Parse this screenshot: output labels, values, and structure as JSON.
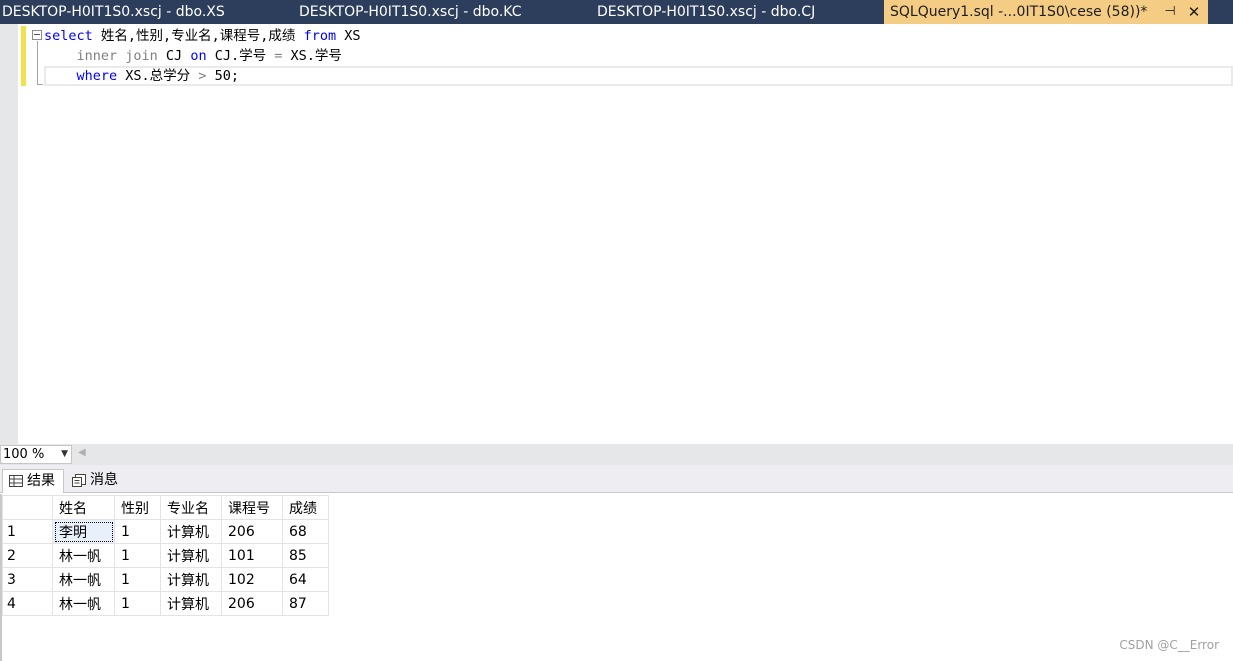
{
  "tabs": [
    {
      "label": "DESKTOP-H0IT1S0.xscj - dbo.XS"
    },
    {
      "label": "DESKTOP-H0IT1S0.xscj - dbo.KC"
    },
    {
      "label": "DESKTOP-H0IT1S0.xscj - dbo.CJ"
    },
    {
      "label": "SQLQuery1.sql -...0IT1S0\\cese (58))*",
      "pin_icon": "pin-icon",
      "close_icon": "close-icon"
    }
  ],
  "editor": {
    "line1": {
      "kw1": "select",
      "text1": " 姓名,性别,专业名,课程号,成绩 ",
      "kw2": "from",
      "text2": " XS"
    },
    "line2": {
      "indent": "    ",
      "fn1": "inner join",
      "text1": " CJ ",
      "kw1": "on",
      "text2": " CJ.学号 ",
      "op": "=",
      "text3": " XS.学号"
    },
    "line3": {
      "indent": "    ",
      "kw1": "where",
      "text1": " XS.总学分 ",
      "op": ">",
      "text2": " 50;"
    }
  },
  "zoom": {
    "value": "100 %"
  },
  "result_tabs": {
    "results": "结果",
    "messages": "消息"
  },
  "grid": {
    "columns": [
      "姓名",
      "性别",
      "专业名",
      "课程号",
      "成绩"
    ],
    "rows": [
      {
        "num": "1",
        "cells": [
          "李明",
          "1",
          "计算机",
          "206",
          "68"
        ]
      },
      {
        "num": "2",
        "cells": [
          "林一帆",
          "1",
          "计算机",
          "101",
          "85"
        ]
      },
      {
        "num": "3",
        "cells": [
          "林一帆",
          "1",
          "计算机",
          "102",
          "64"
        ]
      },
      {
        "num": "4",
        "cells": [
          "林一帆",
          "1",
          "计算机",
          "206",
          "87"
        ]
      }
    ]
  },
  "watermark": "CSDN @C__Error",
  "colors": {
    "tabbar": "#2d3e5c",
    "active_tab": "#f5cc84",
    "keyword": "#0000ff"
  }
}
